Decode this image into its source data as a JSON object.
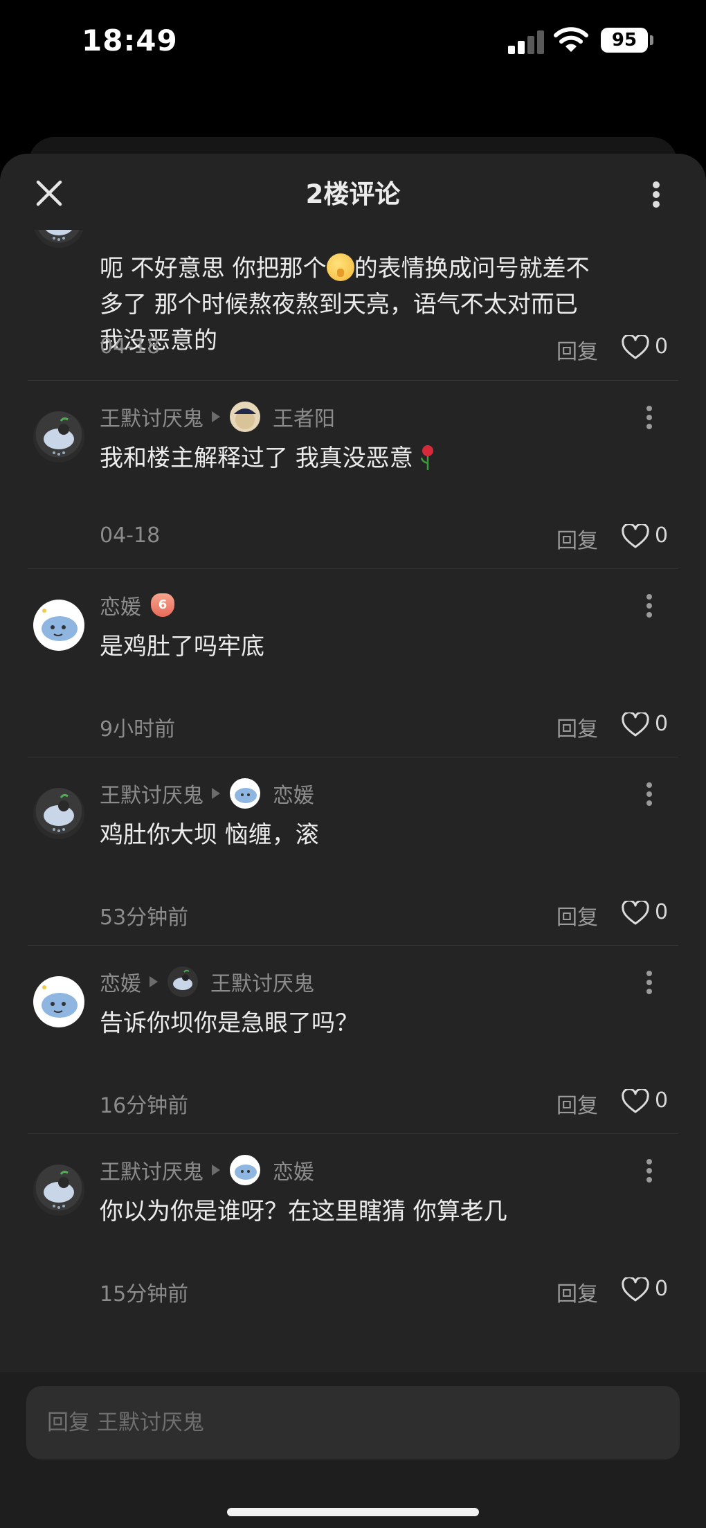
{
  "status_bar": {
    "time": "18:49",
    "battery": "95"
  },
  "header": {
    "title": "2楼评论"
  },
  "comments": [
    {
      "text_lines": [
        "呃 不好意思 你把那个",
        "的表情换成问号就差不",
        "多了 那个时候熬夜熬到天亮，语气不太对而已",
        "我没恶意的"
      ],
      "time": "04-18",
      "reply_label": "回复",
      "likes": "0"
    },
    {
      "author": "王默讨厌鬼",
      "reply_to": "王者阳",
      "text": "我和楼主解释过了 我真没恶意",
      "time": "04-18",
      "reply_label": "回复",
      "likes": "0"
    },
    {
      "author": "恋媛",
      "level_badge": "6",
      "text": "是鸡肚了吗牢底",
      "time": "9小时前",
      "reply_label": "回复",
      "likes": "0"
    },
    {
      "author": "王默讨厌鬼",
      "reply_to": "恋媛",
      "text": "鸡肚你大坝 恼缠，滚",
      "time": "53分钟前",
      "reply_label": "回复",
      "likes": "0"
    },
    {
      "author": "恋媛",
      "reply_to": "王默讨厌鬼",
      "text": "告诉你坝你是急眼了吗？",
      "time": "16分钟前",
      "reply_label": "回复",
      "likes": "0"
    },
    {
      "author": "王默讨厌鬼",
      "reply_to": "恋媛",
      "text": "你以为你是谁呀？在这里瞎猜 你算老几",
      "time": "15分钟前",
      "reply_label": "回复",
      "likes": "0"
    }
  ],
  "footer": {
    "reply_placeholder": "回复 王默讨厌鬼"
  },
  "icons": {
    "close": "close-icon",
    "more": "more-vertical-icon",
    "like": "heart-outline-icon",
    "kebab": "kebab-icon",
    "emoji": "shushing-face-emoji",
    "rose": "rose-emoji"
  },
  "colors": {
    "panel_bg": "#242424",
    "text_primary": "#ececec",
    "text_secondary": "#8c8c8c"
  }
}
